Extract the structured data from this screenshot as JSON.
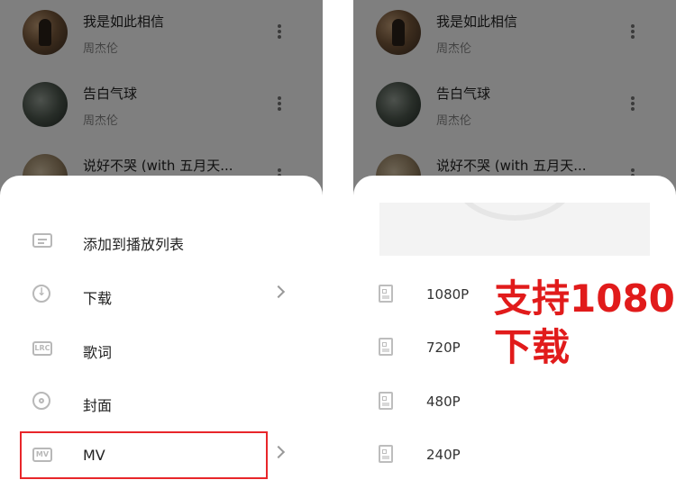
{
  "left_panel": {
    "songs": [
      {
        "title": "我是如此相信",
        "artist": "周杰伦"
      },
      {
        "title": "告白气球",
        "artist": "周杰伦"
      },
      {
        "title": "说好不哭 (with 五月天..."
      }
    ],
    "menu": [
      {
        "label": "添加到播放列表",
        "icon": "playlist-add-icon"
      },
      {
        "label": "下载",
        "icon": "download-icon"
      },
      {
        "label": "歌词",
        "icon": "lyrics-icon",
        "icon_text": "LRC"
      },
      {
        "label": "封面",
        "icon": "cover-disc-icon"
      },
      {
        "label": "MV",
        "icon": "mv-icon",
        "icon_text": "MV"
      }
    ]
  },
  "right_panel": {
    "songs": [
      {
        "title": "我是如此相信",
        "artist": "周杰伦"
      },
      {
        "title": "告白气球",
        "artist": "周杰伦"
      },
      {
        "title": "说好不哭 (with 五月天..."
      }
    ],
    "resolutions": [
      {
        "label": "1080P"
      },
      {
        "label": "720P"
      },
      {
        "label": "480P"
      },
      {
        "label": "240P"
      }
    ]
  },
  "annotation": {
    "line1": "支持1080",
    "line2": "下载",
    "color": "#e11b1b",
    "highlight_color": "#e8262a"
  },
  "colors": {
    "overlay": "rgba(0,0,0,0.5)",
    "sheet": "#ffffff"
  }
}
